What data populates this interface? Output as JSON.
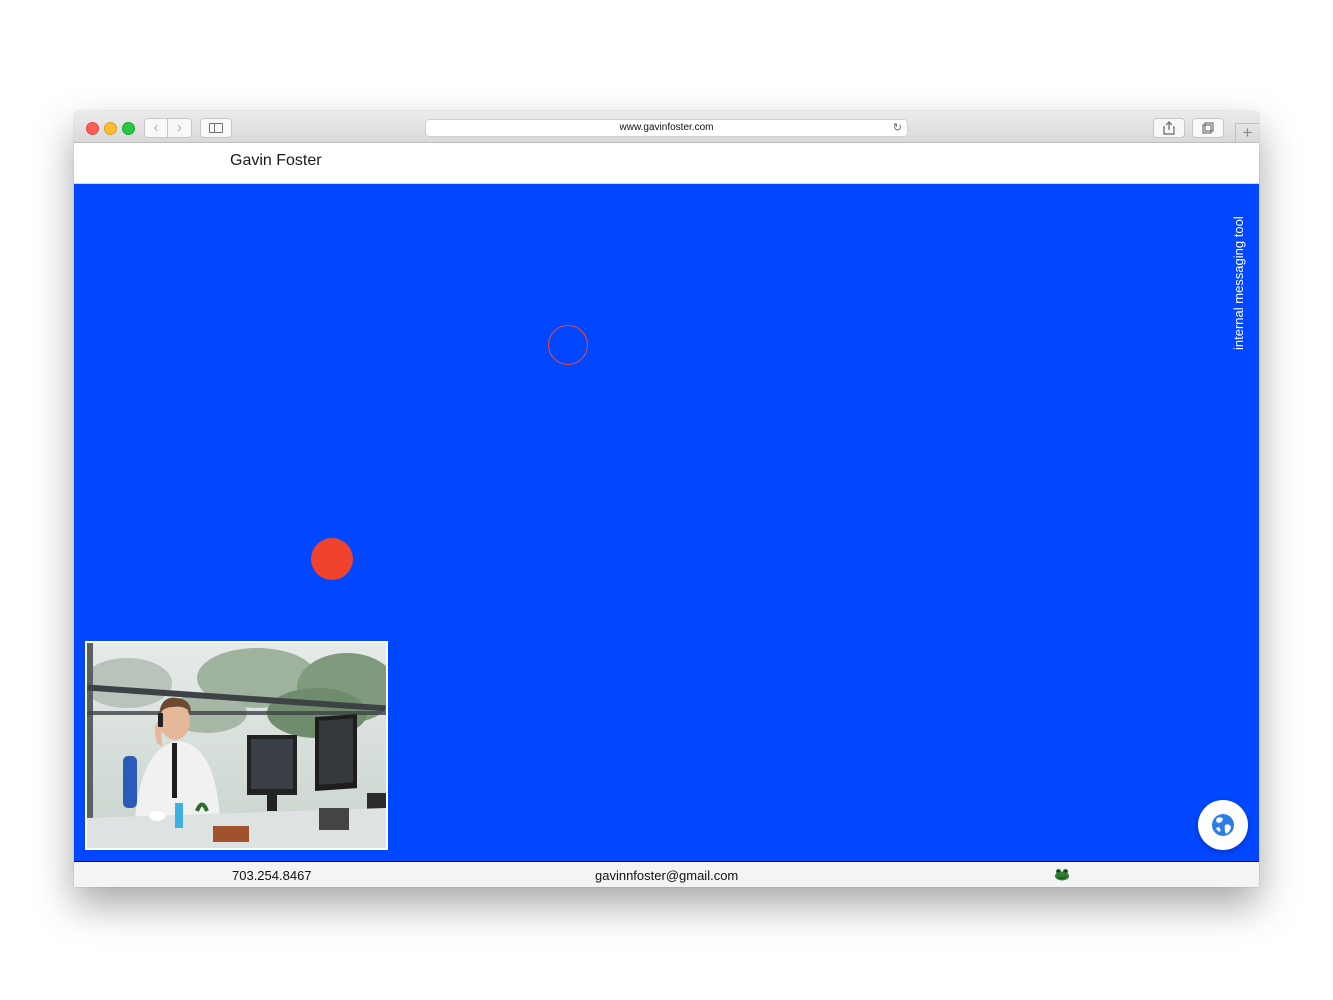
{
  "browser": {
    "url": "www.gavinfoster.com",
    "back_icon": "chevron-left-icon",
    "forward_icon": "chevron-right-icon",
    "sidebar_icon": "sidebar-icon",
    "reload_icon": "reload-icon",
    "share_icon": "share-icon",
    "tabs_icon": "tabs-icon",
    "new_tab_icon": "plus-icon"
  },
  "header": {
    "title": "Gavin Foster"
  },
  "stage": {
    "background_color": "#0047ff",
    "accent_color": "#f0432e",
    "vertical_label": "internal messaging tool",
    "photo_alt": "man-on-phone-at-office-desk",
    "globe_icon": "globe-icon"
  },
  "footer": {
    "phone": "703.254.8467",
    "email": "gavinnfoster@gmail.com",
    "icon": "frog-icon"
  }
}
